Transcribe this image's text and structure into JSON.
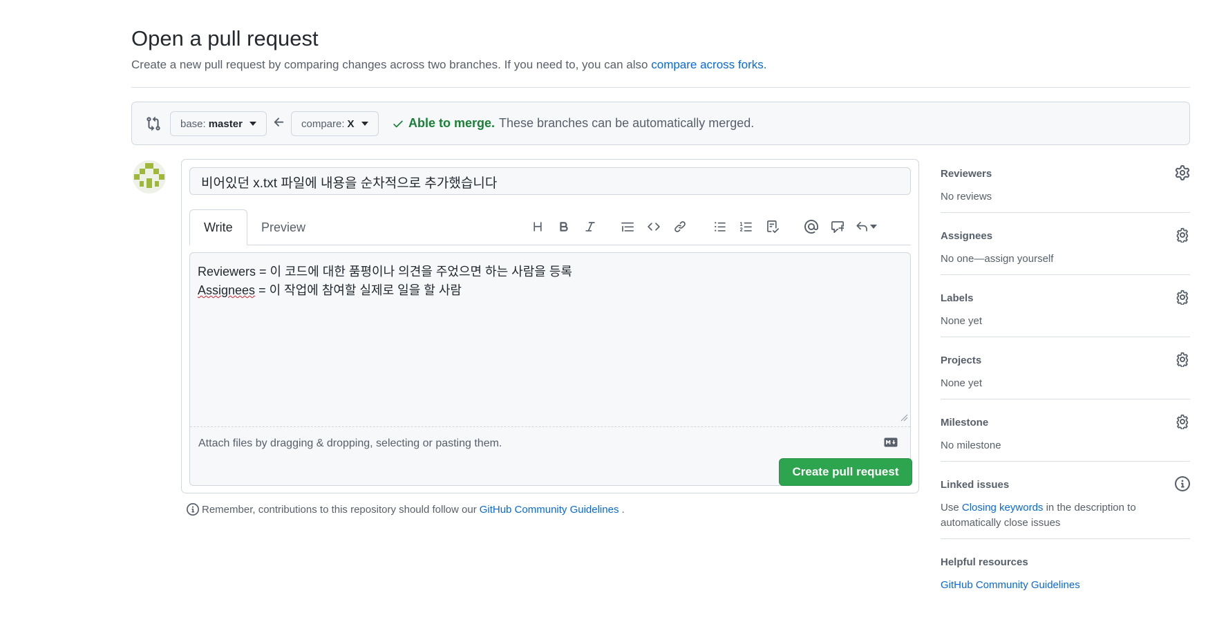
{
  "header": {
    "title": "Open a pull request",
    "subtitle": "Create a new pull request by comparing changes across two branches. If you need to, you can also",
    "subtitle_link": "compare across forks."
  },
  "compare": {
    "base_label": "base:",
    "base_branch": "master",
    "compare_label": "compare:",
    "compare_branch": "X",
    "status_ok": "Able to merge.",
    "status_text": "These branches can be automatically merged."
  },
  "composer": {
    "title_value": "비어있던 x.txt 파일에 내용을 순차적으로 추가했습니다",
    "tabs": [
      {
        "label": "Write",
        "active": true
      },
      {
        "label": "Preview",
        "active": false
      }
    ],
    "body_line1": "Reviewers = 이 코드에 대한 품평이나 의견을 주었으면 하는 사람을 등록",
    "body_line2_word": "Assignees",
    "body_line2_rest": " = 이 작업에 참여할 실제로 일을 할 사람",
    "attach_text": "Attach files by dragging & dropping, selecting or pasting them.",
    "submit_label": "Create pull request"
  },
  "toolbar_icons": [
    "heading-icon",
    "bold-icon",
    "italic-icon",
    "quote-icon",
    "code-icon",
    "link-icon",
    "unordered-list-icon",
    "ordered-list-icon",
    "task-list-icon",
    "mention-icon",
    "reference-icon",
    "reply-icon"
  ],
  "reminder": {
    "text": "Remember, contributions to this repository should follow our",
    "link": "GitHub Community Guidelines",
    "end": "."
  },
  "sidebar": {
    "reviewers": {
      "title": "Reviewers",
      "value": "No reviews"
    },
    "assignees": {
      "title": "Assignees",
      "value": "No one—assign yourself"
    },
    "labels": {
      "title": "Labels",
      "value": "None yet"
    },
    "projects": {
      "title": "Projects",
      "value": "None yet"
    },
    "milestone": {
      "title": "Milestone",
      "value": "No milestone"
    },
    "linked_issues": {
      "title": "Linked issues",
      "prefix": "Use",
      "link": "Closing keywords",
      "suffix": "in the description to automatically close issues"
    },
    "helpful": {
      "title": "Helpful resources",
      "link": "GitHub Community Guidelines"
    }
  },
  "colors": {
    "green": "#2da44e",
    "link": "#0969da",
    "muted": "#57606a",
    "ok": "#1a7f37"
  }
}
